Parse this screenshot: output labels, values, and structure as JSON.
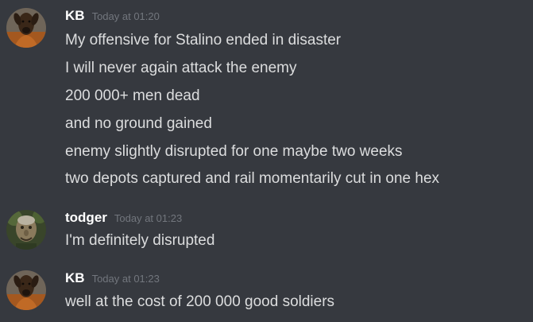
{
  "colors": {
    "background": "#36393f",
    "username": "#ffffff",
    "message_text": "#dcddde",
    "timestamp": "#72767d"
  },
  "messages": [
    {
      "username": "KB",
      "timestamp": "Today at 01:20",
      "avatar_icon": "dog-avatar-icon",
      "lines": [
        "My offensive for Stalino ended in disaster",
        "I will never again attack the enemy",
        "200 000+ men dead",
        "and no ground gained",
        "enemy slightly disrupted for one maybe two weeks",
        "two depots captured and rail momentarily cut in one hex"
      ]
    },
    {
      "username": "todger",
      "timestamp": "Today at 01:23",
      "avatar_icon": "old-man-avatar-icon",
      "lines": [
        "I'm definitely disrupted"
      ]
    },
    {
      "username": "KB",
      "timestamp": "Today at 01:23",
      "avatar_icon": "dog-avatar-icon",
      "lines": [
        "well at the cost of 200 000 good soldiers"
      ]
    }
  ]
}
